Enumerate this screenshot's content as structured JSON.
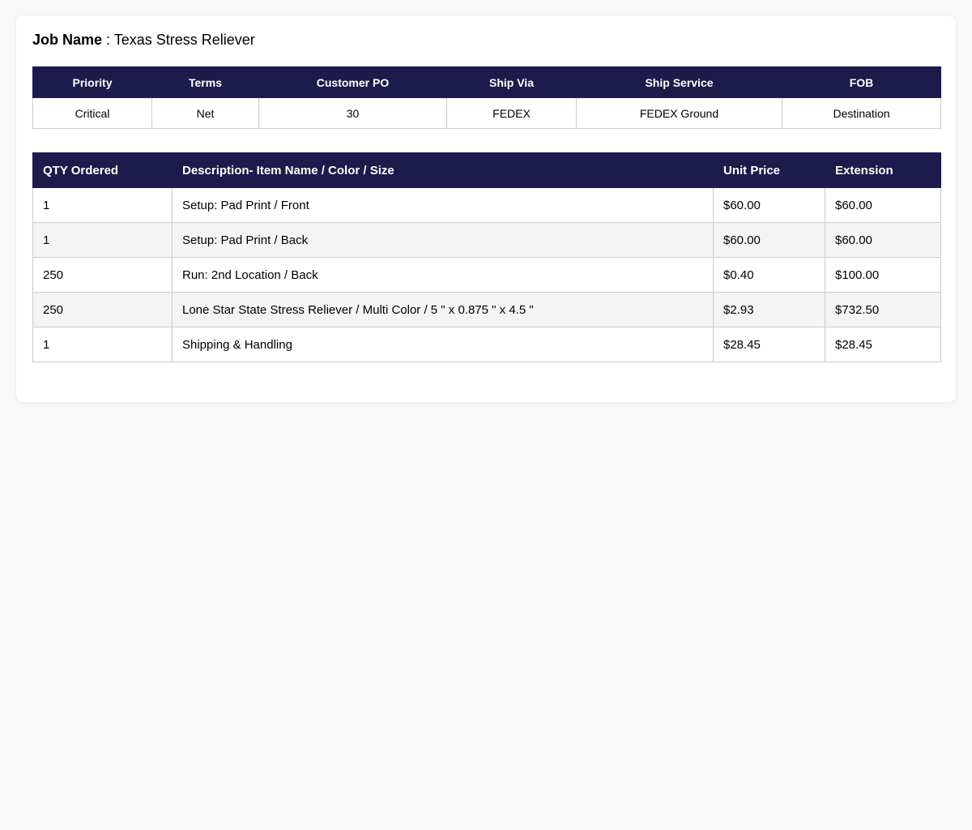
{
  "job": {
    "label": "Job Name",
    "separator": " : ",
    "value": "Texas Stress Reliever"
  },
  "summary": {
    "headers": [
      "Priority",
      "Terms",
      "Customer PO",
      "Ship Via",
      "Ship Service",
      "FOB"
    ],
    "values": [
      "Critical",
      "Net",
      "30",
      "FEDEX",
      "FEDEX Ground",
      "Destination"
    ]
  },
  "items": {
    "headers": [
      "QTY Ordered",
      "Description- Item Name / Color / Size",
      "Unit Price",
      "Extension"
    ],
    "rows": [
      [
        "1",
        "Setup: Pad Print / Front",
        "$60.00",
        "$60.00"
      ],
      [
        "1",
        "Setup: Pad Print / Back",
        "$60.00",
        "$60.00"
      ],
      [
        "250",
        "Run: 2nd Location / Back",
        "$0.40",
        "$100.00"
      ],
      [
        "250",
        "Lone Star State Stress Reliever / Multi Color / 5 \" x 0.875 \" x 4.5 \"",
        "$2.93",
        "$732.50"
      ],
      [
        "1",
        "Shipping & Handling",
        "$28.45",
        "$28.45"
      ]
    ]
  },
  "colors": {
    "header_bg": "#1c1b4b",
    "header_text": "#ffffff",
    "stripe": "#f4f4f4",
    "page_bg": "#f8f8f8"
  }
}
